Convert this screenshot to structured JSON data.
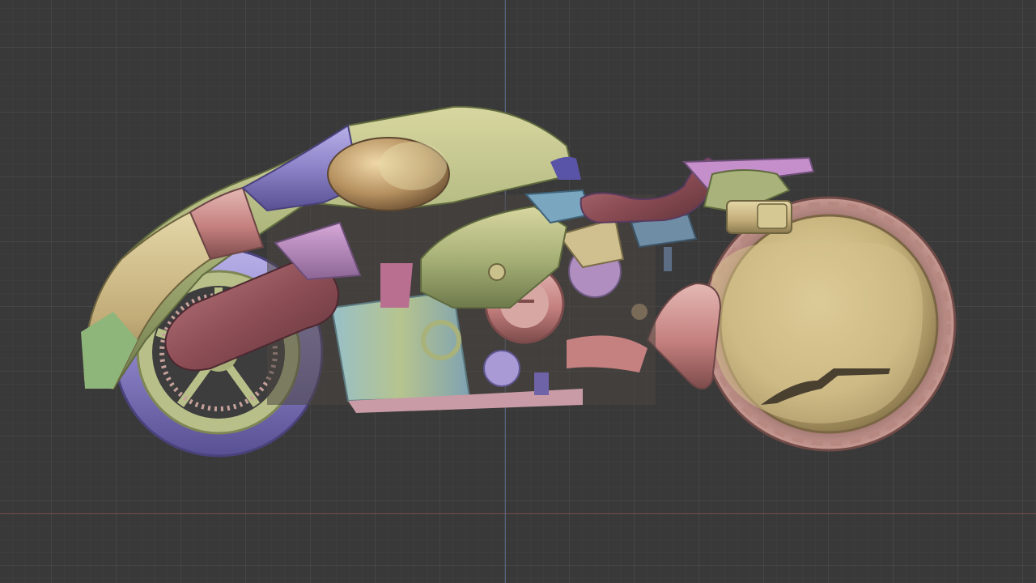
{
  "viewport": {
    "background_color": "#393939",
    "grid_color": "#444444",
    "x_axis_color": "#A8595C",
    "y_axis_color": "#6B86BD"
  },
  "model": {
    "shading": "matcap-random-color",
    "palette": [
      "#C9BD82",
      "#A9B77A",
      "#8D84C7",
      "#C98E8E",
      "#B78ABF",
      "#7FB2B5",
      "#C7B892"
    ]
  }
}
